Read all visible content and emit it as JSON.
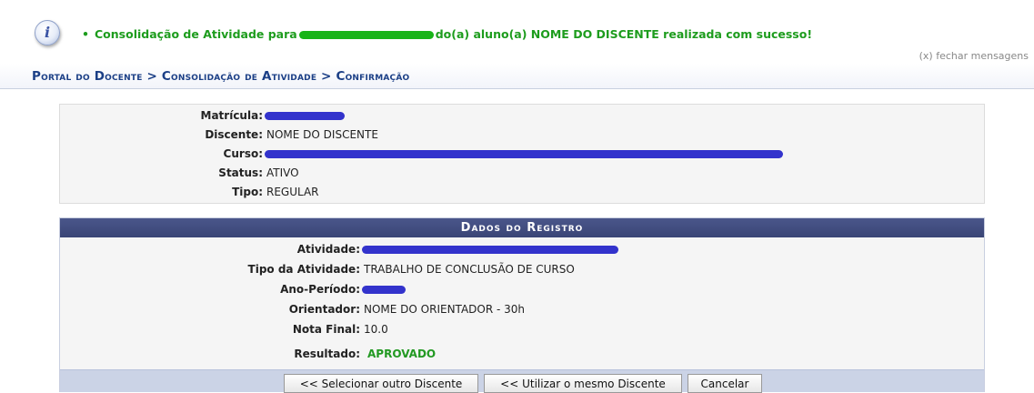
{
  "message": {
    "icon": "info-icon",
    "bullet": "•",
    "prefix": "Consolidação de Atividade para",
    "suffix": "do(a) aluno(a) NOME DO DISCENTE realizada com sucesso!",
    "close_label": "(x) fechar mensagens",
    "color": "#1d9c1d"
  },
  "breadcrumb": {
    "text": "Portal do Docente > Consolidação de Atividade > Confirmação"
  },
  "student": {
    "matricula_label": "Matrícula:",
    "discente_label": "Discente:",
    "discente_value": "NOME DO DISCENTE",
    "curso_label": "Curso:",
    "status_label": "Status:",
    "status_value": "ATIVO",
    "tipo_label": "Tipo:",
    "tipo_value": "REGULAR"
  },
  "registro": {
    "title": "Dados do Registro",
    "atividade_label": "Atividade:",
    "tipo_atividade_label": "Tipo da Atividade:",
    "tipo_atividade_value": "TRABALHO DE CONCLUSÃO DE CURSO",
    "ano_periodo_label": "Ano-Período:",
    "orientador_label": "Orientador:",
    "orientador_value": "NOME DO ORIENTADOR - 30h",
    "nota_label": "Nota Final:",
    "nota_value": "10.0",
    "resultado_label": "Resultado:",
    "resultado_value": "APROVADO",
    "result_color": "#229922"
  },
  "buttons": {
    "selecionar_outro": "<< Selecionar outro Discente",
    "utilizar_mesmo": "<< Utilizar o mesmo Discente",
    "cancelar": "Cancelar"
  },
  "colors": {
    "header_bg": "#3a4576",
    "breadcrumb": "#1b3f86",
    "redaction": "#3333cc"
  }
}
